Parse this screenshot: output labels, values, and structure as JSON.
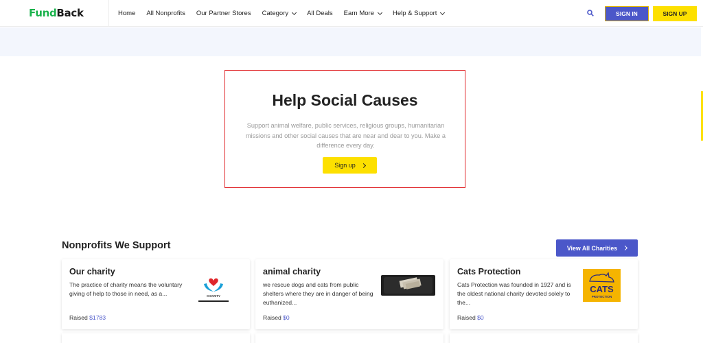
{
  "header": {
    "logo": {
      "part1": "Fund",
      "part2": "Back"
    },
    "nav": [
      {
        "label": "Home",
        "dropdown": false
      },
      {
        "label": "All Nonprofits",
        "dropdown": false
      },
      {
        "label": "Our Partner Stores",
        "dropdown": false
      },
      {
        "label": "Category",
        "dropdown": true
      },
      {
        "label": "All Deals",
        "dropdown": false
      },
      {
        "label": "Earn More",
        "dropdown": true
      },
      {
        "label": "Help & Support",
        "dropdown": true
      }
    ],
    "search_icon": "search-icon",
    "signin_label": "SIGN IN",
    "signup_label": "SIGN UP"
  },
  "hero": {
    "title": "Help Social Causes",
    "description": "Support animal welfare, public services, religious groups, humanitarian missions and other social causes that are near and dear to you. Make a difference every day.",
    "button_label": "Sign up"
  },
  "nonprofits": {
    "title": "Nonprofits We Support",
    "view_all_label": "View All Charities",
    "raised_label": "Raised",
    "cards": [
      {
        "title": "Our charity",
        "description": "The practice of charity means the voluntary giving of help to those in need, as a...",
        "raised": "$1783",
        "image_text": "CHARITY"
      },
      {
        "title": "animal charity",
        "description": "we rescue dogs and cats from public shelters where they are in danger of being euthanized...",
        "raised": "$0"
      },
      {
        "title": "Cats Protection",
        "description": "Cats Protection was founded in 1927 and is the oldest national charity devoted solely to the...",
        "raised": "$0",
        "image_text": "CATS",
        "image_subtext": "PROTECTION"
      }
    ]
  },
  "colors": {
    "brand_green": "#19b24b",
    "primary_blue": "#4b57c9",
    "accent_yellow": "#fde000",
    "highlight_red": "#e0262a"
  }
}
